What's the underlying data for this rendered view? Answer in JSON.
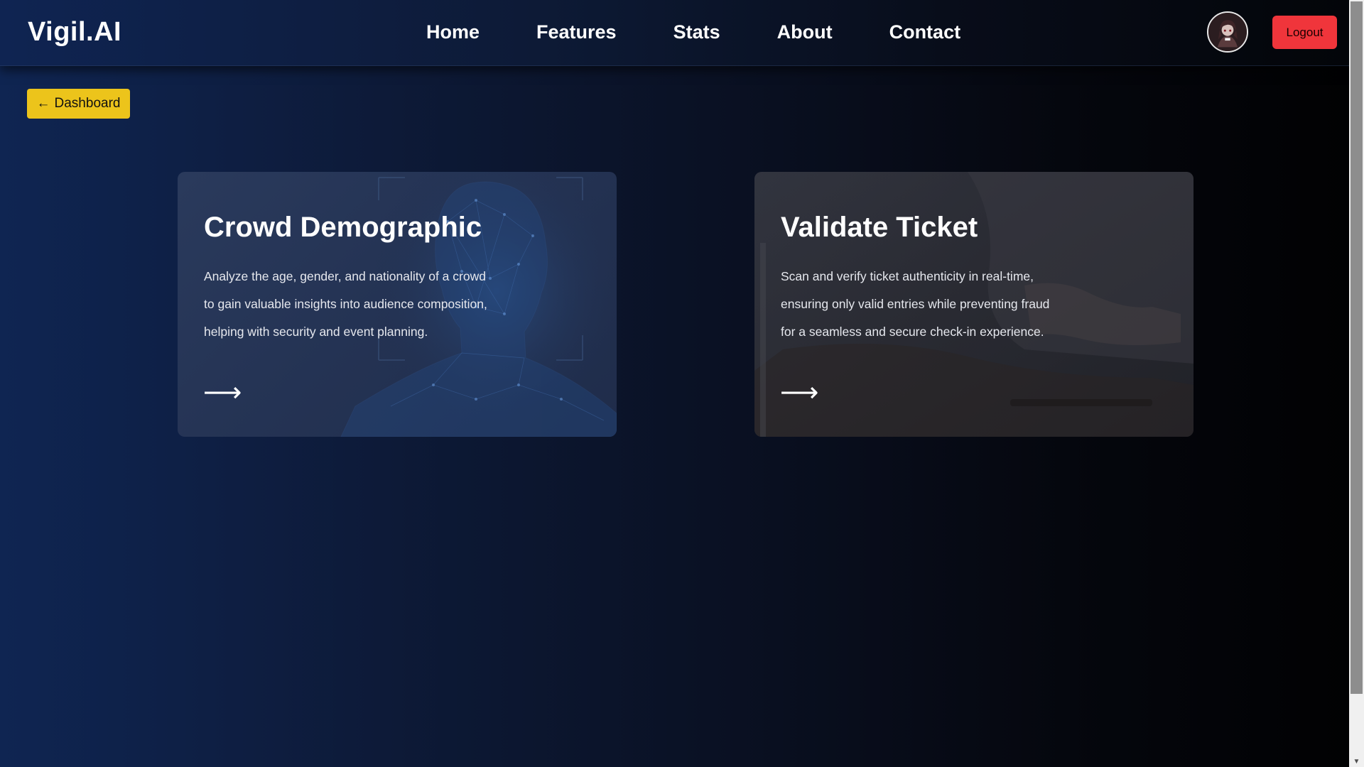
{
  "header": {
    "brand": "Vigil.AI",
    "nav": [
      {
        "label": "Home"
      },
      {
        "label": "Features"
      },
      {
        "label": "Stats"
      },
      {
        "label": "About"
      },
      {
        "label": "Contact"
      }
    ],
    "avatar_icon": "user-avatar-icon",
    "logout_label": "Logout"
  },
  "back_button": {
    "arrow": "←",
    "label": "Dashboard"
  },
  "cards": [
    {
      "title": "Crowd Demographic",
      "lines": [
        "Analyze the age, gender, and nationality of a crowd",
        "to gain valuable insights into audience composition,",
        "helping with security and event planning."
      ],
      "arrow": "⟶",
      "bg_icon": "ai-head-wireframe-icon"
    },
    {
      "title": "Validate Ticket",
      "lines": [
        "Scan and verify ticket authenticity in real-time,",
        "ensuring only valid entries while preventing fraud",
        "for a seamless and secure check-in experience."
      ],
      "arrow": "⟶",
      "bg_icon": "ticket-scan-photo-icon"
    }
  ],
  "colors": {
    "accent_yellow": "#ecc41b",
    "logout_red": "#f0353b",
    "background_left": "#0f2552",
    "background_right": "#010102"
  }
}
